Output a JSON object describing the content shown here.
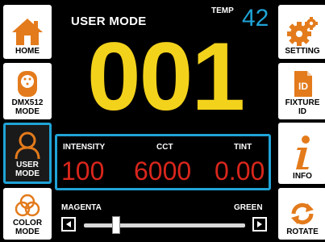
{
  "sidebar_left": {
    "home": "HOME",
    "dmx_line1": "DMX512",
    "dmx_line2": "MODE",
    "user_line1": "USER",
    "user_line2": "MODE",
    "color_line1": "COLOR",
    "color_line2": "MODE"
  },
  "sidebar_right": {
    "setting": "SETTING",
    "fixture_line1": "FIXTURE",
    "fixture_line2": "ID",
    "info": "INFO",
    "rotate": "ROTATE"
  },
  "header": {
    "mode_title": "USER MODE",
    "temp_label": "TEMP",
    "temp_value": "42"
  },
  "address": "001",
  "panel": {
    "intensity_label": "INTENSITY",
    "intensity_value": "100",
    "cct_label": "CCT",
    "cct_value": "6000",
    "tint_label": "TINT",
    "tint_value": "0.00"
  },
  "tint_slider": {
    "left_label": "MAGENTA",
    "right_label": "GREEN",
    "position_fraction": 0.2
  },
  "colors": {
    "accent_blue": "#1fa3d6",
    "address_yellow": "#f3d21c",
    "value_red": "#d9261c",
    "icon_orange": "#e37b1c"
  }
}
